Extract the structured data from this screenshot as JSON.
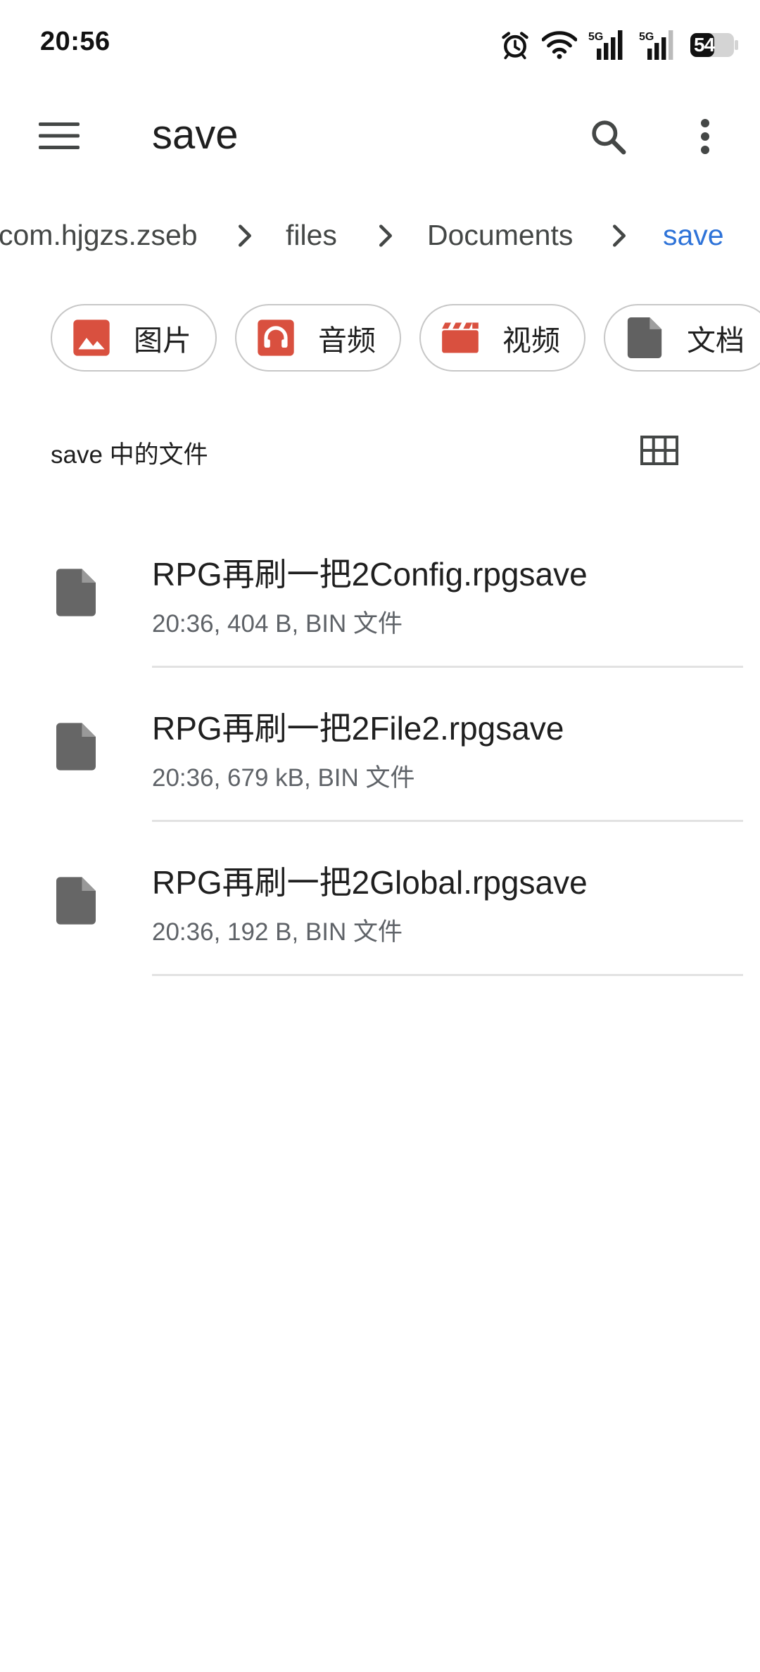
{
  "status_bar": {
    "time": "20:56",
    "battery_level": "54",
    "icons": [
      "alarm-icon",
      "wifi-icon",
      "signal-5g-icon",
      "signal-5g-icon",
      "battery-icon"
    ]
  },
  "app_bar": {
    "title": "save",
    "icons": [
      "menu-icon",
      "search-icon",
      "more-vert-icon"
    ]
  },
  "breadcrumb": {
    "items": [
      {
        "label": "com.hjgzs.zseb",
        "active": false
      },
      {
        "label": "files",
        "active": false
      },
      {
        "label": "Documents",
        "active": false
      },
      {
        "label": "save",
        "active": true
      }
    ],
    "active_color": "#2e73d8"
  },
  "chips": [
    {
      "label": "图片",
      "icon": "image-icon",
      "color": "#d9503f"
    },
    {
      "label": "音频",
      "icon": "headphones-icon",
      "color": "#d9503f"
    },
    {
      "label": "视频",
      "icon": "video-icon",
      "color": "#d9503f"
    },
    {
      "label": "文档",
      "icon": "document-icon",
      "color": "#616161"
    }
  ],
  "section": {
    "title": "save 中的文件",
    "view_toggle_icon": "grid-view-icon"
  },
  "files": [
    {
      "name": "RPG再刷一把2Config.rpgsave",
      "meta": "20:36, 404 B, BIN 文件",
      "icon": "file-icon"
    },
    {
      "name": "RPG再刷一把2File2.rpgsave",
      "meta": "20:36, 679 kB, BIN 文件",
      "icon": "file-icon"
    },
    {
      "name": "RPG再刷一把2Global.rpgsave",
      "meta": "20:36, 192 B, BIN 文件",
      "icon": "file-icon"
    }
  ]
}
